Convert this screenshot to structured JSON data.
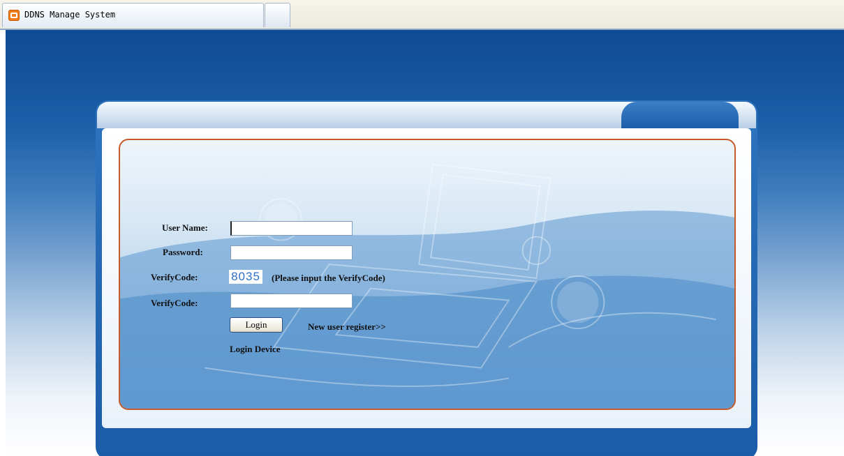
{
  "browser": {
    "tab_title": "DDNS Manage System",
    "tab_icon": "app-icon",
    "new_tab_icon": "new-tab-icon"
  },
  "colors": {
    "page_bg_top": "#0f4a93",
    "frame": "#1b5ca8",
    "panel_border": "#c65a2a",
    "verify_code_text": "#2d6fc9"
  },
  "form": {
    "username_label": "User Name:",
    "username_value": "",
    "password_label": "Password:",
    "password_value": "",
    "verifycode_display_label": "VerifyCode:",
    "verifycode_value": "8035",
    "verifycode_hint": "(Please input the VerifyCode)",
    "verifycode_input_label": "VerifyCode:",
    "verifycode_input_value": "",
    "login_button": "Login",
    "register_link": "New user register>>",
    "login_device_link": "Login Device"
  }
}
